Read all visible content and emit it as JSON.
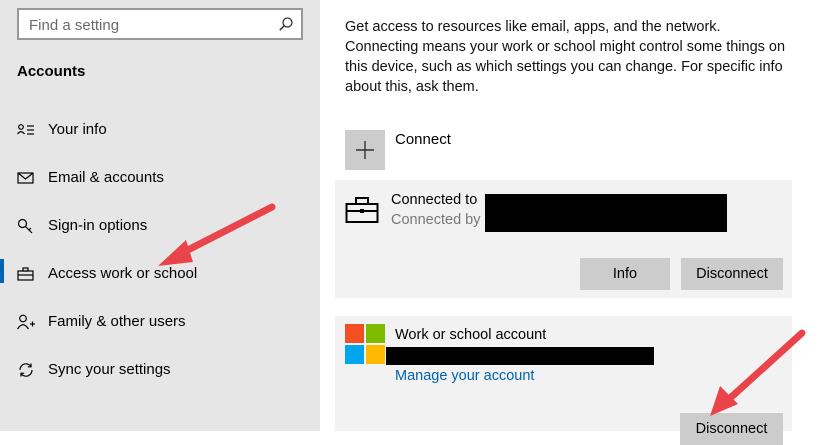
{
  "sidebar": {
    "search": {
      "placeholder": "Find a setting",
      "icon": "search-icon"
    },
    "section_title": "Accounts",
    "items": [
      {
        "label": "Your info",
        "icon": "person-card-icon",
        "active": false
      },
      {
        "label": "Email & accounts",
        "icon": "envelope-icon",
        "active": false
      },
      {
        "label": "Sign-in options",
        "icon": "key-icon",
        "active": false
      },
      {
        "label": "Access work or school",
        "icon": "briefcase-icon",
        "active": true
      },
      {
        "label": "Family & other users",
        "icon": "person-plus-icon",
        "active": false
      },
      {
        "label": "Sync your settings",
        "icon": "sync-icon",
        "active": false
      }
    ]
  },
  "main": {
    "description": "Get access to resources like email, apps, and the network. Connecting means your work or school might control some things on this device, such as which settings you can change. For specific info about this, ask them.",
    "connect_label": "Connect",
    "connected_card": {
      "line1": "Connected to",
      "line2": "Connected by",
      "info_button": "Info",
      "disconnect_button": "Disconnect"
    },
    "work_card": {
      "title": "Work or school account",
      "manage_link": "Manage your account",
      "disconnect_button": "Disconnect"
    }
  },
  "colors": {
    "accent": "#0063b1",
    "annotation_arrow": "#e8444a"
  }
}
